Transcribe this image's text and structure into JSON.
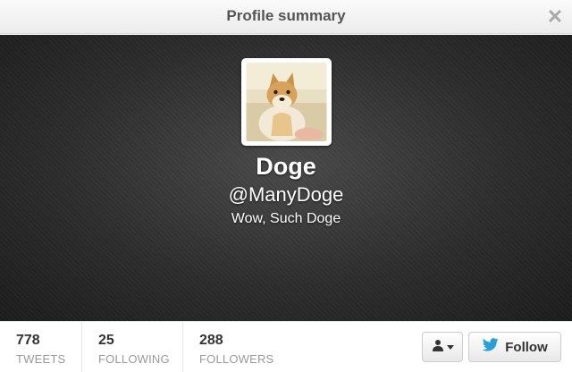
{
  "header": {
    "title": "Profile summary",
    "close_icon": "close-icon"
  },
  "profile": {
    "name": "Doge",
    "handle": "@ManyDoge",
    "bio": "Wow, Such Doge"
  },
  "stats": [
    {
      "count": "778",
      "label": "TWEETS"
    },
    {
      "count": "25",
      "label": "FOLLOWING"
    },
    {
      "count": "288",
      "label": "FOLLOWERS"
    }
  ],
  "actions": {
    "follow_label": "Follow",
    "follow_icon": "twitter-bird-icon",
    "user_dropdown_icon": "user-icon"
  },
  "colors": {
    "banner": "#2c2c2c",
    "twitter_blue": "#2a9fd6"
  }
}
